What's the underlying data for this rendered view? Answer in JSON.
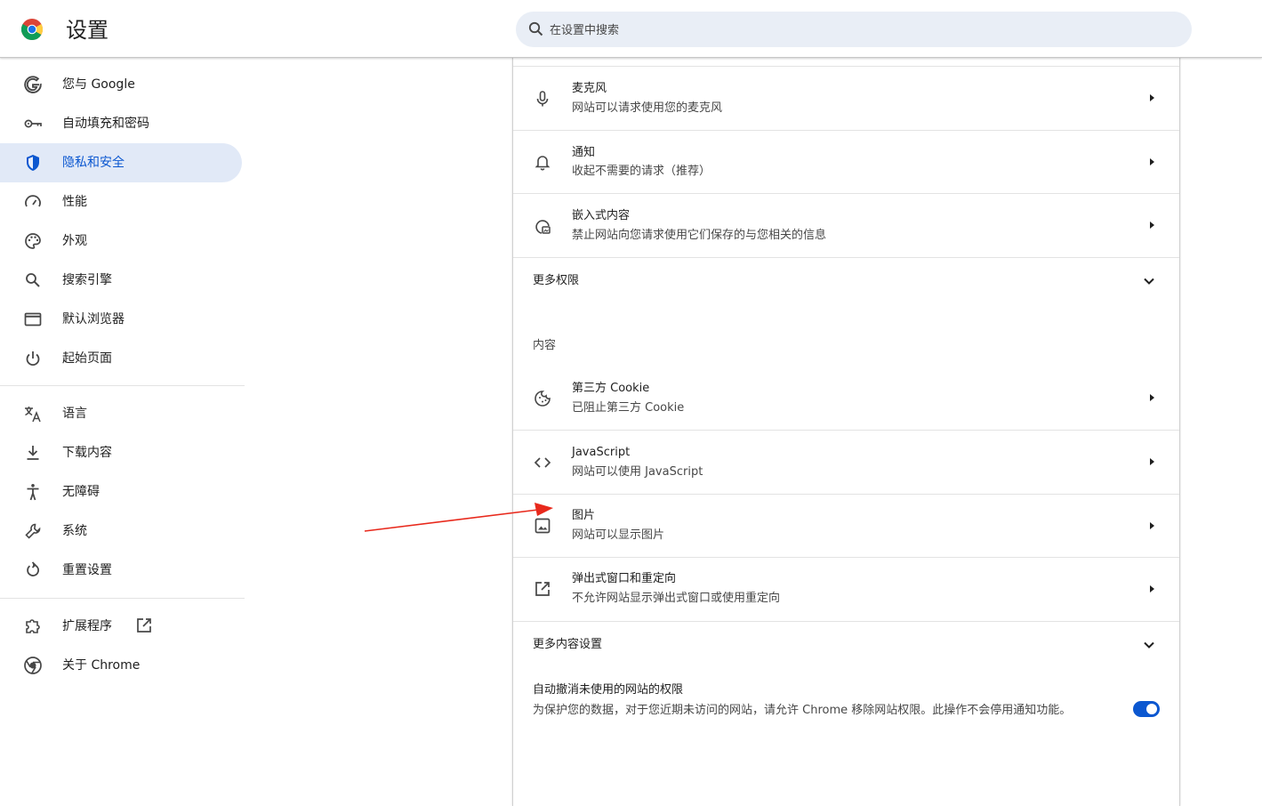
{
  "header": {
    "title": "设置",
    "search_placeholder": "在设置中搜索"
  },
  "sidebar": {
    "items": [
      {
        "label": "您与 Google",
        "icon": "google-g-icon",
        "active": false
      },
      {
        "label": "自动填充和密码",
        "icon": "key-icon",
        "active": false
      },
      {
        "label": "隐私和安全",
        "icon": "shield-icon",
        "active": true
      },
      {
        "label": "性能",
        "icon": "speedometer-icon",
        "active": false
      },
      {
        "label": "外观",
        "icon": "palette-icon",
        "active": false
      },
      {
        "label": "搜索引擎",
        "icon": "search-icon",
        "active": false
      },
      {
        "label": "默认浏览器",
        "icon": "browser-window-icon",
        "active": false
      },
      {
        "label": "起始页面",
        "icon": "power-icon",
        "active": false
      },
      {
        "label": "语言",
        "icon": "translate-icon",
        "active": false
      },
      {
        "label": "下载内容",
        "icon": "download-icon",
        "active": false
      },
      {
        "label": "无障碍",
        "icon": "accessibility-icon",
        "active": false
      },
      {
        "label": "系统",
        "icon": "wrench-icon",
        "active": false
      },
      {
        "label": "重置设置",
        "icon": "reset-icon",
        "active": false
      },
      {
        "label": "扩展程序",
        "icon": "puzzle-icon",
        "active": false
      },
      {
        "label": "关于 Chrome",
        "icon": "chrome-logo-icon",
        "active": false
      }
    ]
  },
  "main": {
    "permissions": [
      {
        "title": "麦克风",
        "subtitle": "网站可以请求使用您的麦克风",
        "icon": "microphone-icon"
      },
      {
        "title": "通知",
        "subtitle": "收起不需要的请求（推荐）",
        "icon": "bell-icon"
      },
      {
        "title": "嵌入式内容",
        "subtitle": "禁止网站向您请求使用它们保存的与您相关的信息",
        "icon": "embedded-content-icon"
      }
    ],
    "more_permissions_label": "更多权限",
    "content_heading": "内容",
    "content": [
      {
        "title": "第三方 Cookie",
        "subtitle": "已阻止第三方 Cookie",
        "icon": "cookie-icon"
      },
      {
        "title": "JavaScript",
        "subtitle": "网站可以使用 JavaScript",
        "icon": "code-icon"
      },
      {
        "title": "图片",
        "subtitle": "网站可以显示图片",
        "icon": "image-icon"
      },
      {
        "title": "弹出式窗口和重定向",
        "subtitle": "不允许网站显示弹出式窗口或使用重定向",
        "icon": "open-external-icon"
      }
    ],
    "more_content_label": "更多内容设置",
    "auto_revoke": {
      "title": "自动撤消未使用的网站的权限",
      "description": "为保护您的数据，对于您近期未访问的网站，请允许 Chrome 移除网站权限。此操作不会停用通知功能。",
      "enabled": true
    }
  },
  "colors": {
    "accent": "#0b57d0",
    "active_nav_bg": "#e1e9f7",
    "search_bg": "#e9eef6",
    "annotation_arrow": "#e8291c"
  }
}
